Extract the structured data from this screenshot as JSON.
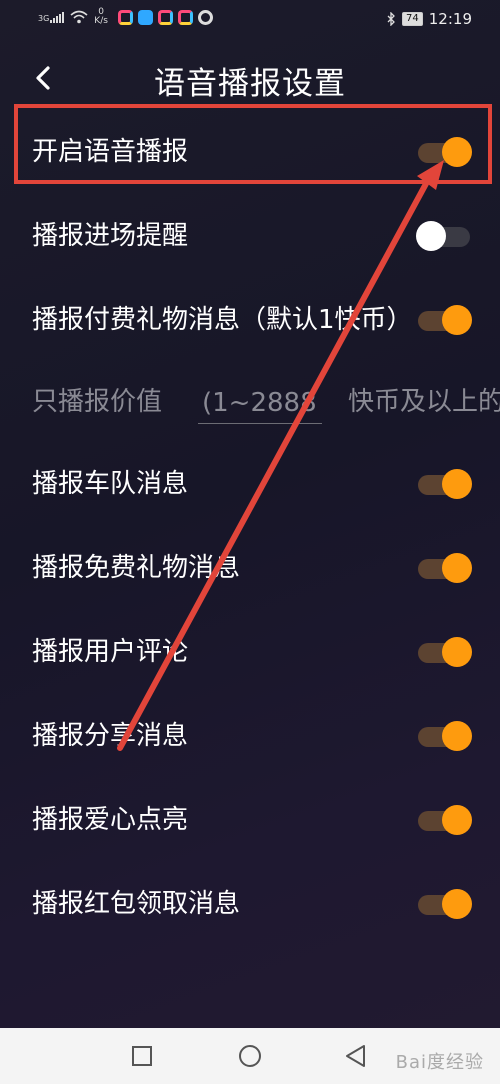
{
  "status_bar": {
    "signal_label": "3G",
    "speed_value": "0",
    "speed_unit": "K/s",
    "battery": "74",
    "time": "12:19"
  },
  "header": {
    "title": "语音播报设置",
    "back_icon": "chevron-left-icon"
  },
  "settings": [
    {
      "label": "开启语音播报",
      "on": true
    },
    {
      "label": "播报进场提醒",
      "on": false
    },
    {
      "label": "播报付费礼物消息（默认1快币）",
      "on": true
    },
    {
      "label": "播报车队消息",
      "on": true
    },
    {
      "label": "播报免费礼物消息",
      "on": true
    },
    {
      "label": "播报用户评论",
      "on": true
    },
    {
      "label": "播报分享消息",
      "on": true
    },
    {
      "label": "播报爱心点亮",
      "on": true
    },
    {
      "label": "播报红包领取消息",
      "on": true
    }
  ],
  "value_threshold": {
    "prefix": "只播报价值",
    "placeholder": "(1~2888)",
    "suffix": "快币及以上的"
  },
  "nav": {
    "items": [
      "square-icon",
      "circle-icon",
      "triangle-back-icon"
    ]
  },
  "watermark": "Bai度经验",
  "colors": {
    "toggle_on_knob": "#fe9b0e",
    "toggle_on_track": "#5c4331",
    "toggle_off_knob": "#ffffff",
    "annotation": "#e2453a"
  }
}
